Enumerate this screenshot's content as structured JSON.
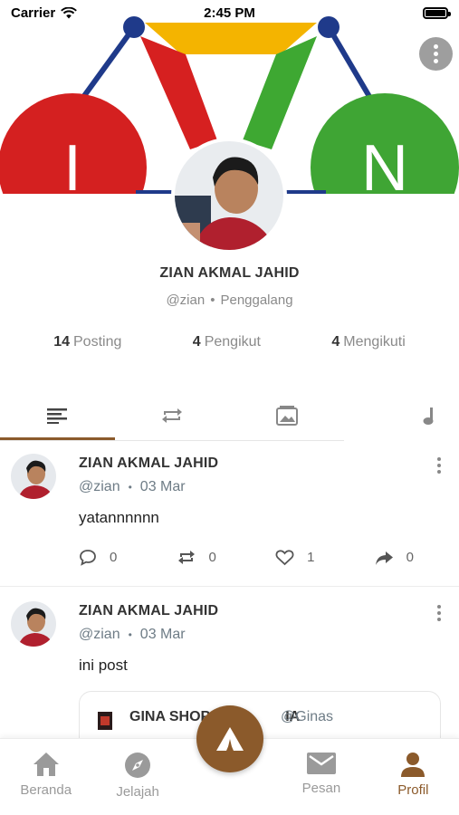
{
  "status_bar": {
    "carrier": "Carrier",
    "time": "2:45 PM"
  },
  "cover": {
    "left_letter": "I",
    "right_letter": "N"
  },
  "profile": {
    "name": "ZIAN AKMAL JAHID",
    "handle": "@zian",
    "role": "Penggalang",
    "stats": [
      {
        "count": "14",
        "label": "Posting"
      },
      {
        "count": "4",
        "label": "Pengikut"
      },
      {
        "count": "4",
        "label": "Mengikuti"
      }
    ]
  },
  "tabs": [
    "posts-tab",
    "reposts-tab",
    "media-tab",
    "audio-tab"
  ],
  "posts": [
    {
      "name": "ZIAN AKMAL JAHID",
      "handle": "@zian",
      "date": "03 Mar",
      "text": "yatannnnnn",
      "comments": "0",
      "reposts": "0",
      "likes": "1",
      "shares": "0"
    },
    {
      "name": "ZIAN AKMAL JAHID",
      "handle": "@zian",
      "date": "03 Mar",
      "text": "ini post",
      "quote": {
        "name": "GINA SHOP",
        "name_tail": "IA",
        "handle": "@Ginas"
      }
    }
  ],
  "nav": {
    "items": [
      {
        "label": "Beranda",
        "icon": "home-icon"
      },
      {
        "label": "Jelajah",
        "icon": "compass-icon"
      },
      {
        "label": "Pesan",
        "icon": "mail-icon"
      },
      {
        "label": "Profil",
        "icon": "person-icon"
      }
    ],
    "accent": "#8B5A2B"
  }
}
